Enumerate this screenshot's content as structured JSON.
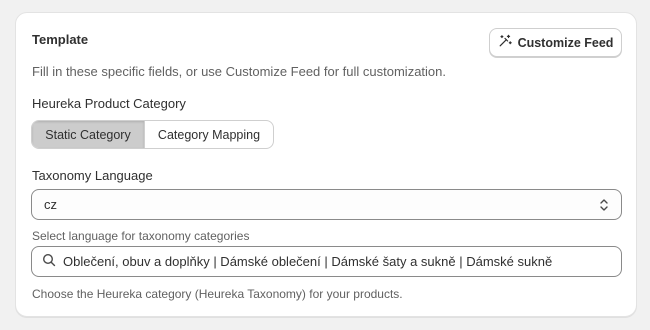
{
  "card": {
    "title": "Template",
    "subtitle": "Fill in these specific fields, or use Customize Feed for full customization.",
    "customize_button": {
      "label": "Customize Feed",
      "icon": "magic-wand-icon"
    }
  },
  "category": {
    "label": "Heureka Product Category",
    "segments": [
      {
        "label": "Static Category",
        "selected": true
      },
      {
        "label": "Category Mapping",
        "selected": false
      }
    ]
  },
  "taxonomy_language": {
    "label": "Taxonomy Language",
    "value": "cz",
    "help": "Select language for taxonomy categories",
    "icon": "chevron-up-down-icon"
  },
  "taxonomy_search": {
    "value": "Oblečení, obuv a doplňky | Dámské oblečení | Dámské šaty a sukně | Dámské sukně",
    "help": "Choose the Heureka category (Heureka Taxonomy) for your products.",
    "icon": "search-icon"
  },
  "colors": {
    "page_bg": "#f1f1f1",
    "card_bg": "#ffffff",
    "segment_active_bg": "#cccccc",
    "text_primary": "#303030",
    "text_secondary": "#616161"
  }
}
